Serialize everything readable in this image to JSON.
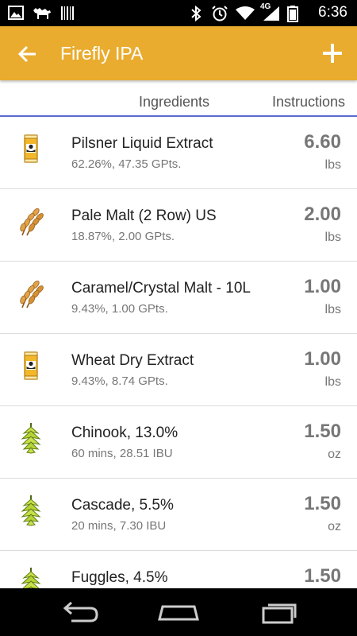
{
  "status_bar": {
    "time": "6:36",
    "network": "4G",
    "icons": [
      "image-icon",
      "camel-icon",
      "barcode-icon",
      "bluetooth-icon",
      "alarm-icon",
      "wifi-icon",
      "signal-icon",
      "battery-icon"
    ]
  },
  "app_bar": {
    "title": "Firefly IPA",
    "back_icon": "arrow-back-icon",
    "add_icon": "plus-icon",
    "background": "#e9ac2f"
  },
  "tabs": [
    {
      "label": "Ingredients",
      "selected": true
    },
    {
      "label": "Instructions",
      "selected": false
    }
  ],
  "ingredients": [
    {
      "icon": "extract-can-icon",
      "name": "Pilsner Liquid Extract",
      "detail": "62.26%, 47.35 GPts.",
      "amount": "6.60",
      "unit": "lbs"
    },
    {
      "icon": "grain-icon",
      "name": "Pale Malt (2 Row) US",
      "detail": "18.87%, 2.00 GPts.",
      "amount": "2.00",
      "unit": "lbs"
    },
    {
      "icon": "grain-icon",
      "name": "Caramel/Crystal Malt - 10L",
      "detail": "9.43%, 1.00 GPts.",
      "amount": "1.00",
      "unit": "lbs"
    },
    {
      "icon": "extract-can-icon",
      "name": "Wheat Dry Extract",
      "detail": "9.43%, 8.74 GPts.",
      "amount": "1.00",
      "unit": "lbs"
    },
    {
      "icon": "hop-icon",
      "name": "Chinook, 13.0%",
      "detail": "60 mins, 28.51 IBU",
      "amount": "1.50",
      "unit": "oz"
    },
    {
      "icon": "hop-icon",
      "name": "Cascade, 5.5%",
      "detail": "20 mins, 7.30 IBU",
      "amount": "1.50",
      "unit": "oz"
    },
    {
      "icon": "hop-icon",
      "name": "Fuggles, 4.5%",
      "detail": "",
      "amount": "1.50",
      "unit": ""
    }
  ],
  "nav_bar": {
    "buttons": [
      "back-nav-icon",
      "home-nav-icon",
      "recents-nav-icon"
    ]
  }
}
